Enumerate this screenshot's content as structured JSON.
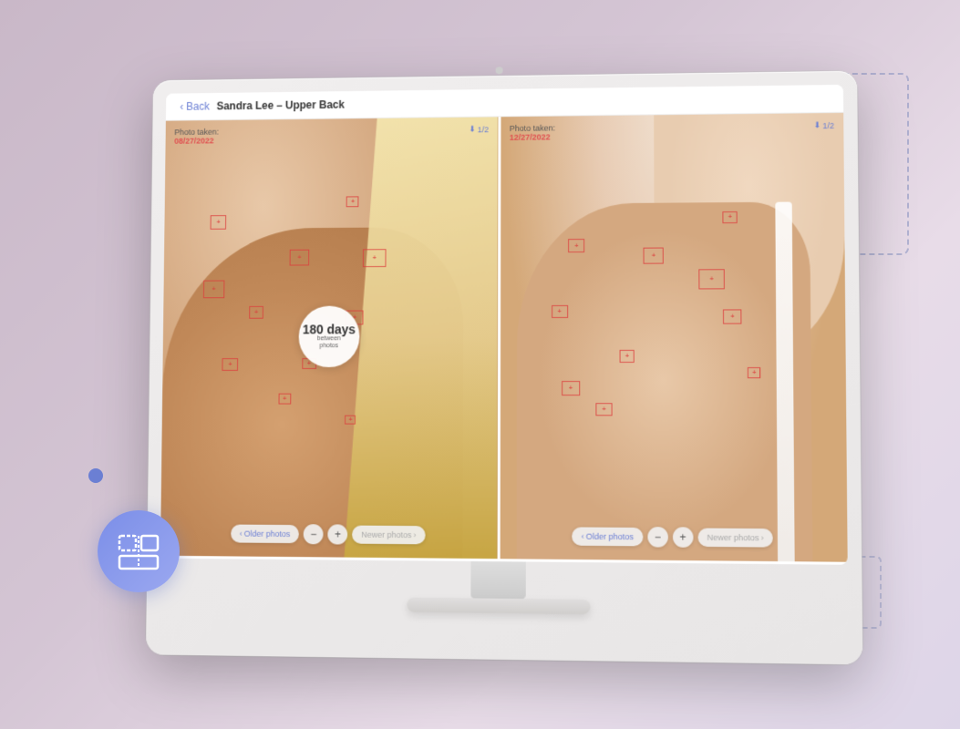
{
  "app": {
    "title": "Sandra Lee – Upper Back",
    "back_label": "Back"
  },
  "panel_left": {
    "photo_taken_label": "Photo taken:",
    "date": "08/27/2022",
    "download_label": "1/2",
    "older_photos": "Older photos",
    "newer_photos": "Newer photos"
  },
  "panel_right": {
    "photo_taken_label": "Photo taken:",
    "date": "12/27/2022",
    "download_label": "1/2",
    "older_photos": "Older photos",
    "newer_photos": "Newer photos"
  },
  "days_badge": {
    "number": "180 days",
    "line2": "between",
    "line3": "photos"
  },
  "icon_badge": {
    "name": "comparison-icon"
  },
  "colors": {
    "accent": "#6b7fd4",
    "danger": "#dc3c3c",
    "text_dark": "#333333",
    "text_muted": "#666666"
  }
}
